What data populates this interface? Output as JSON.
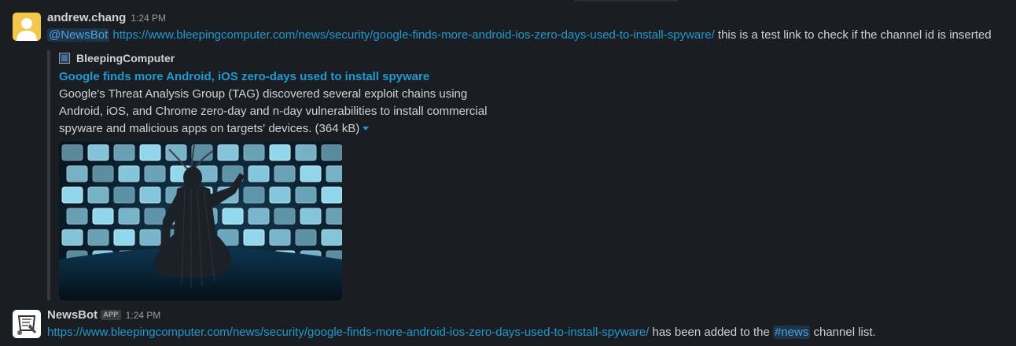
{
  "messages": [
    {
      "author": "andrew.chang",
      "time": "1:24 PM",
      "avatar_icon": "user-silhouette-icon",
      "avatar_bg": "#f2c74a",
      "mention": "@NewsBot",
      "link": "https://www.bleepingcomputer.com/news/security/google-finds-more-android-ios-zero-days-used-to-install-spyware/",
      "text_after": " this is a test link to check if the channel id is inserted",
      "unfurl": {
        "site_name": "BleepingComputer",
        "site_icon": "bleepingcomputer-favicon-icon",
        "title": "Google finds more Android, iOS zero-days used to install spyware",
        "description": "Google's Threat Analysis Group (TAG) discovered several exploit chains using Android, iOS, and Chrome zero-day and n-day vulnerabilities to install commercial spyware and malicious apps on targets' devices.",
        "file_size": "(364 kB)",
        "image_alt": "figure sitting in front of a wall of glowing blue screens"
      }
    },
    {
      "author": "NewsBot",
      "badge": "APP",
      "time": "1:24 PM",
      "avatar_icon": "newsbot-logo-icon",
      "link": "https://www.bleepingcomputer.com/news/security/google-finds-more-android-ios-zero-days-used-to-install-spyware/",
      "text_before_channel": " has been added to the ",
      "channel": "#news",
      "text_after_channel": " channel list."
    }
  ],
  "colors": {
    "background": "#1a1d21",
    "text": "#d1d2d3",
    "link": "#1d9bd1",
    "mention_bg": "#1f3447",
    "screen_glow": "#8fe6ff"
  }
}
